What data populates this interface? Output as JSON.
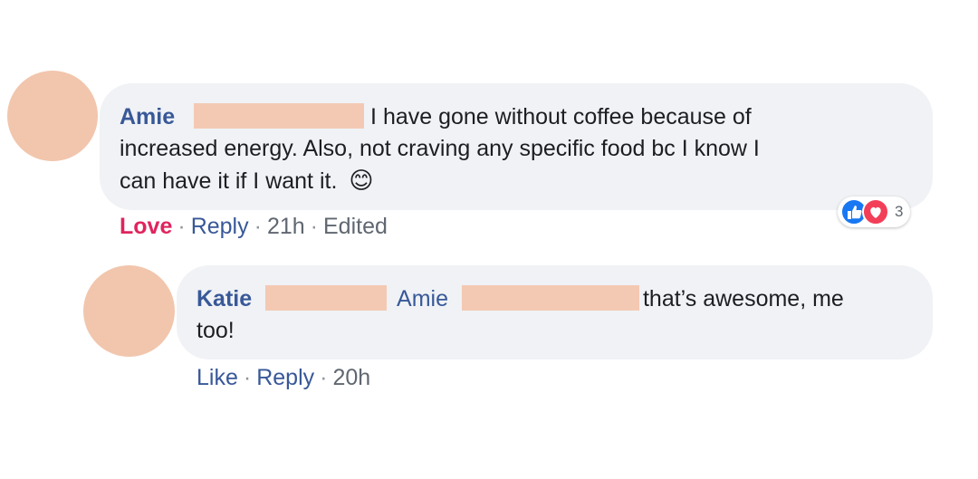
{
  "comments": [
    {
      "author": "Amie",
      "text_1": "I have gone without coffee because of",
      "text_2": "increased energy. Also, not craving any specific food bc I know I",
      "text_3": "can have it if I want it.",
      "emoji": "😊",
      "reaction_label": "Love",
      "reply_label": "Reply",
      "time": "21h",
      "edited": "Edited",
      "reaction_count": "3",
      "reaction_icons": [
        "like-icon",
        "love-icon"
      ]
    },
    {
      "author": "Katie",
      "mention": "Amie",
      "text_1": "that’s awesome, me",
      "text_2": "too!",
      "like_label": "Like",
      "reply_label": "Reply",
      "time": "20h"
    }
  ],
  "separator": "·",
  "colors": {
    "avatar": "#f1c6ad",
    "redaction": "#f4c9b3",
    "link": "#385898",
    "love": "#e0245e",
    "bubble": "#f0f2f5"
  }
}
